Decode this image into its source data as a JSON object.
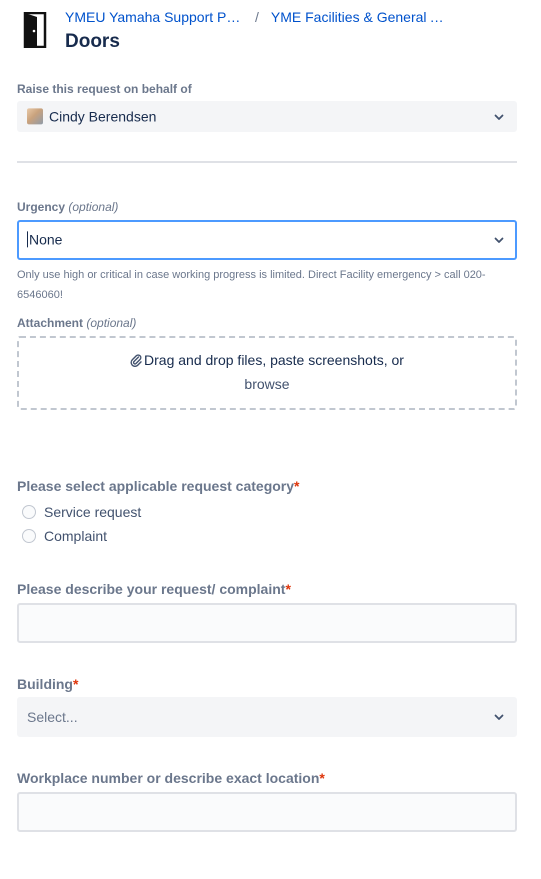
{
  "header": {
    "breadcrumbs": [
      "YMEU Yamaha Support Portal",
      "YME Facilities & General Affairs"
    ],
    "breadcrumb_separator": "/",
    "title": "Doors",
    "icon": "door-icon"
  },
  "behalf": {
    "label": "Raise this request on behalf of",
    "value": "Cindy Berendsen"
  },
  "urgency": {
    "label": "Urgency",
    "optional_text": "(optional)",
    "value": "None",
    "help": "Only use high or critical in case working progress is limited. Direct Facility emergency > call 020-6546060!"
  },
  "attachment": {
    "label": "Attachment",
    "optional_text": "(optional)",
    "drop_text": "Drag and drop files, paste screenshots, or",
    "browse_text": "browse"
  },
  "category": {
    "label": "Please select applicable request category",
    "required_mark": "*",
    "options": [
      "Service request",
      "Complaint"
    ]
  },
  "describe": {
    "label": "Please describe your request/ complaint",
    "required_mark": "*",
    "value": ""
  },
  "building": {
    "label": "Building",
    "required_mark": "*",
    "placeholder": "Select..."
  },
  "workplace": {
    "label": "Workplace number or describe exact location",
    "required_mark": "*",
    "value": ""
  },
  "colors": {
    "link": "#0052cc",
    "required": "#de350b",
    "focus": "#4c9aff"
  }
}
